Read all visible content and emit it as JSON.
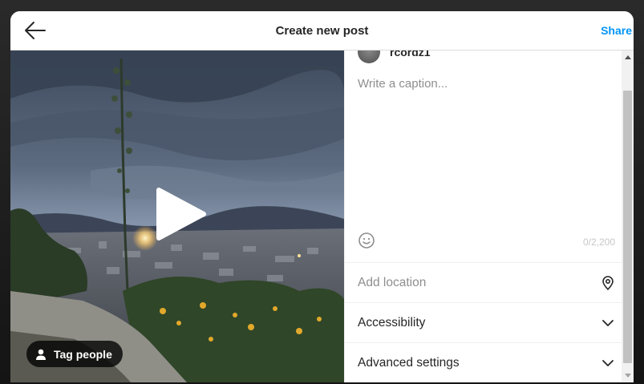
{
  "header": {
    "title": "Create new post",
    "share_label": "Share"
  },
  "media": {
    "tag_people_label": "Tag people"
  },
  "panel": {
    "username": "rcordz1",
    "caption_placeholder": "Write a caption...",
    "char_count": "0/2,200",
    "rows": {
      "location": "Add location",
      "accessibility": "Accessibility",
      "advanced": "Advanced settings"
    }
  },
  "colors": {
    "accent": "#0095f6",
    "text": "#262626",
    "muted": "#8e8e8e"
  },
  "icons": {
    "back": "arrow-left-icon",
    "play": "play-icon",
    "tag": "person-icon",
    "emoji": "smiley-icon",
    "location": "location-pin-icon",
    "chevron": "chevron-down-icon"
  }
}
